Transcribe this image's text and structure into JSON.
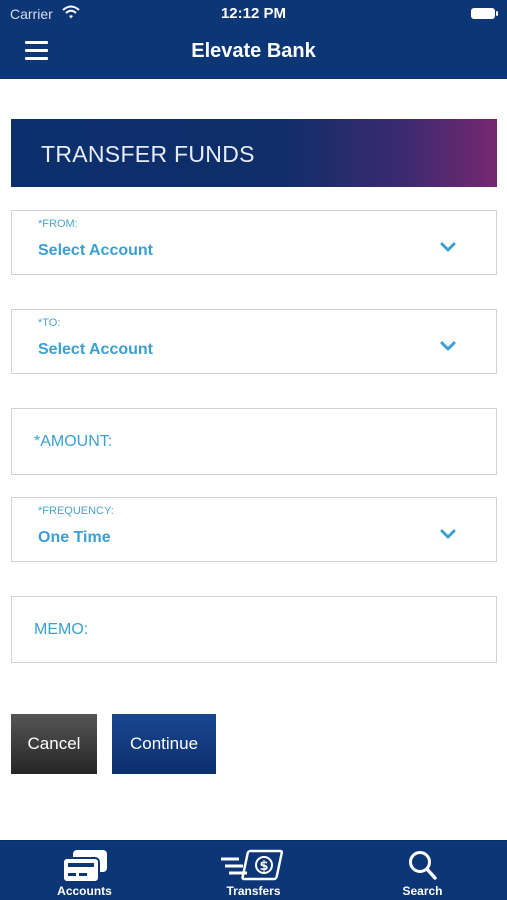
{
  "status_bar": {
    "carrier": "Carrier",
    "time": "12:12 PM"
  },
  "header": {
    "title": "Elevate Bank",
    "menu_icon": "hamburger-menu-icon"
  },
  "banner": {
    "title": "TRANSFER FUNDS"
  },
  "form": {
    "from": {
      "label": "*FROM:",
      "value": "Select Account"
    },
    "to": {
      "label": "*TO:",
      "value": "Select Account"
    },
    "amount": {
      "label": "*AMOUNT:"
    },
    "frequency": {
      "label": "*FREQUENCY:",
      "value": "One Time"
    },
    "memo": {
      "label": "MEMO:"
    }
  },
  "buttons": {
    "cancel": "Cancel",
    "continue": "Continue"
  },
  "tabbar": {
    "items": [
      {
        "label": "Accounts",
        "icon": "cards-icon"
      },
      {
        "label": "Transfers",
        "icon": "money-transfer-icon"
      },
      {
        "label": "Search",
        "icon": "search-icon"
      }
    ]
  },
  "colors": {
    "brand_navy": "#0c3675",
    "field_blue": "#3a9fd1",
    "banner_gradient_end": "#76286f"
  }
}
